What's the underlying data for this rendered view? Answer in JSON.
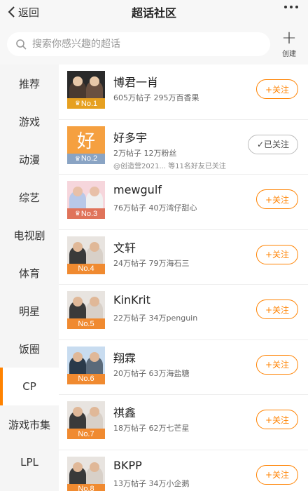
{
  "header": {
    "back_label": "返回",
    "title": "超话社区"
  },
  "search": {
    "placeholder": "搜索你感兴趣的超话",
    "create_label": "创建"
  },
  "sidebar": {
    "items": [
      {
        "label": "推荐"
      },
      {
        "label": "游戏"
      },
      {
        "label": "动漫"
      },
      {
        "label": "综艺"
      },
      {
        "label": "电视剧"
      },
      {
        "label": "体育"
      },
      {
        "label": "明星"
      },
      {
        "label": "饭圈"
      },
      {
        "label": "CP"
      },
      {
        "label": "游戏市集"
      },
      {
        "label": "LPL"
      }
    ],
    "active_index": 8
  },
  "list": {
    "items": [
      {
        "name": "博君一肖",
        "stats": "605万帖子 295万百香果",
        "rank": "No.1",
        "button": "+关注",
        "note": "",
        "theme": "dark"
      },
      {
        "name": "好多宇",
        "stats": "2万帖子 12万粉丝",
        "rank": "No.2",
        "button": "✓已关注",
        "note": "@创造营2021... 等11名好友已关注",
        "theme": "orange"
      },
      {
        "name": "mewgulf",
        "stats": "76万帖子 40万湾仔甜心",
        "rank": "No.3",
        "button": "+关注",
        "note": "",
        "theme": "pink"
      },
      {
        "name": "文轩",
        "stats": "24万帖子 79万海石三",
        "rank": "No.4",
        "button": "+关注",
        "note": "",
        "theme": "light"
      },
      {
        "name": "KinKrit",
        "stats": "22万帖子 34万penguin",
        "rank": "No.5",
        "button": "+关注",
        "note": "",
        "theme": "light"
      },
      {
        "name": "翔霖",
        "stats": "20万帖子 63万海盐糖",
        "rank": "No.6",
        "button": "+关注",
        "note": "",
        "theme": "blue"
      },
      {
        "name": "祺鑫",
        "stats": "18万帖子 62万七芒星",
        "rank": "No.7",
        "button": "+关注",
        "note": "",
        "theme": "light"
      },
      {
        "name": "BKPP",
        "stats": "13万帖子 34万小企鹅",
        "rank": "No.8",
        "button": "+关注",
        "note": "",
        "theme": "light"
      }
    ]
  },
  "colors": {
    "accent": "#ff8200",
    "gold_rank": "#e6a020",
    "silver_rank": "#8aa4c4",
    "bronze_rank": "#e0735a",
    "orange_rank": "#f08a30"
  },
  "icons": {
    "back": "chevron-left-icon",
    "more": "more-dots-icon",
    "search": "search-icon",
    "create": "plus-icon"
  }
}
